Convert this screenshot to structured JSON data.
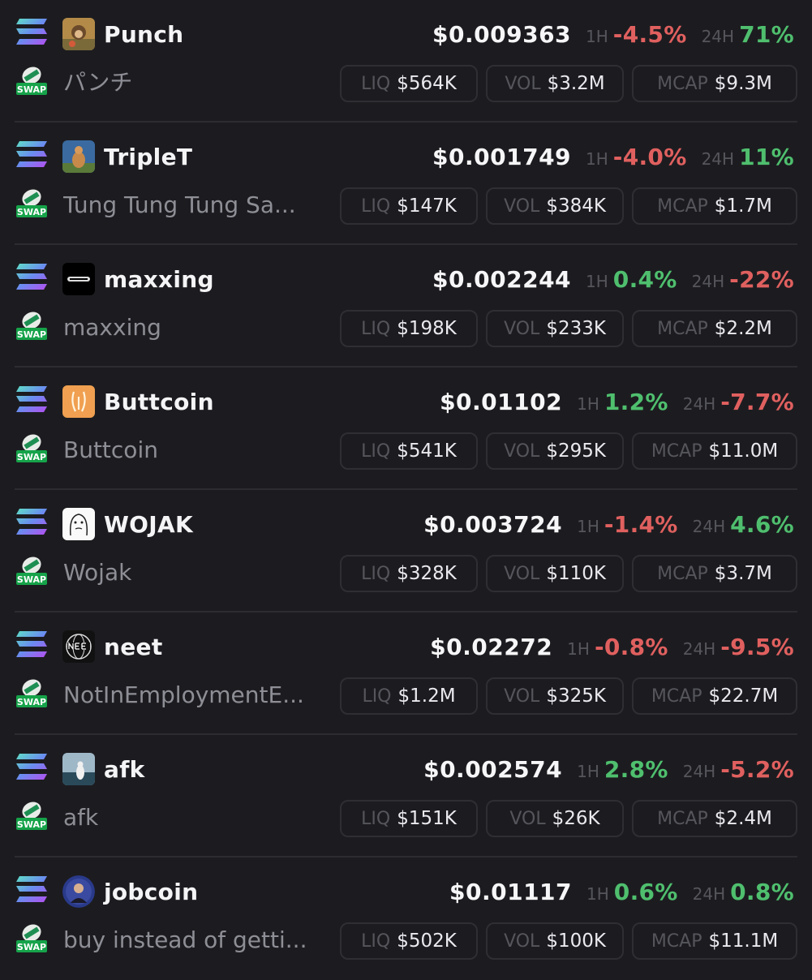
{
  "labels": {
    "h1": "1H",
    "h24": "24H",
    "liq": "LIQ",
    "vol": "VOL",
    "mcap": "MCAP",
    "swap": "SWAP"
  },
  "colors": {
    "positive": "#4fbf6e",
    "negative": "#e0605f",
    "background": "#1c1c20"
  },
  "tokens": [
    {
      "symbol": "Punch",
      "name": "パンチ",
      "price": "$0.009363",
      "change_1h": "-4.5%",
      "change_24h": "71%",
      "liq": "$564K",
      "vol": "$3.2M",
      "mcap": "$9.3M",
      "avatar_icon": "monkey-photo-icon"
    },
    {
      "symbol": "TripleT",
      "name": "Tung Tung Tung Sa...",
      "price": "$0.001749",
      "change_1h": "-4.0%",
      "change_24h": "11%",
      "liq": "$147K",
      "vol": "$384K",
      "mcap": "$1.7M",
      "avatar_icon": "alpaca-photo-icon"
    },
    {
      "symbol": "maxxing",
      "name": "maxxing",
      "price": "$0.002244",
      "change_1h": "0.4%",
      "change_24h": "-22%",
      "liq": "$198K",
      "vol": "$233K",
      "mcap": "$2.2M",
      "avatar_icon": "maxxing-logo-icon"
    },
    {
      "symbol": "Buttcoin",
      "name": "Buttcoin",
      "price": "$0.01102",
      "change_1h": "1.2%",
      "change_24h": "-7.7%",
      "liq": "$541K",
      "vol": "$295K",
      "mcap": "$11.0M",
      "avatar_icon": "buttcoin-logo-icon"
    },
    {
      "symbol": "WOJAK",
      "name": "Wojak",
      "price": "$0.003724",
      "change_1h": "-1.4%",
      "change_24h": "4.6%",
      "liq": "$328K",
      "vol": "$110K",
      "mcap": "$3.7M",
      "avatar_icon": "wojak-face-icon"
    },
    {
      "symbol": "neet",
      "name": "NotInEmploymentE...",
      "price": "$0.02272",
      "change_1h": "-0.8%",
      "change_24h": "-9.5%",
      "liq": "$1.2M",
      "vol": "$325K",
      "mcap": "$22.7M",
      "avatar_icon": "neet-globe-icon"
    },
    {
      "symbol": "afk",
      "name": "afk",
      "price": "$0.002574",
      "change_1h": "2.8%",
      "change_24h": "-5.2%",
      "liq": "$151K",
      "vol": "$26K",
      "mcap": "$2.4M",
      "avatar_icon": "afk-photo-icon"
    },
    {
      "symbol": "jobcoin",
      "name": "buy instead of getti...",
      "price": "$0.01117",
      "change_1h": "0.6%",
      "change_24h": "0.8%",
      "liq": "$502K",
      "vol": "$100K",
      "mcap": "$11.1M",
      "avatar_icon": "jobcoin-avatar-icon"
    }
  ]
}
